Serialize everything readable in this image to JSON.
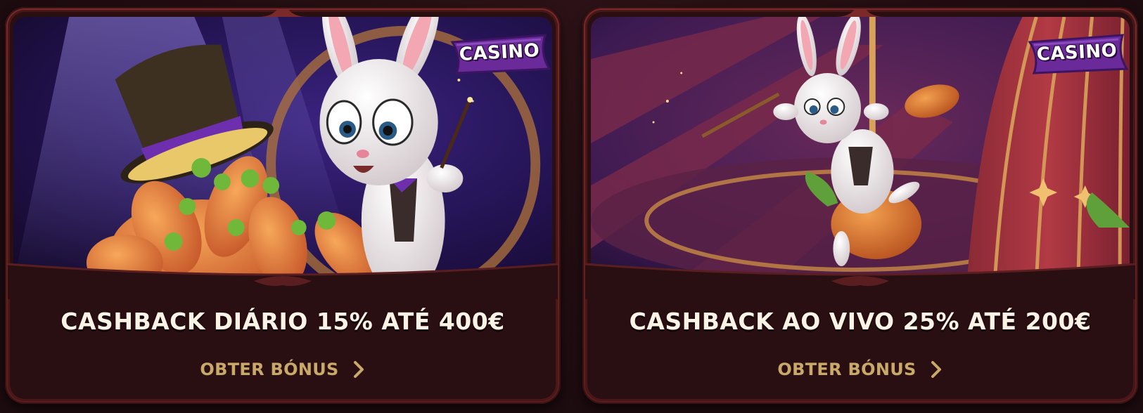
{
  "cards": [
    {
      "badge": "CASINO",
      "title": "CASHBACK DIÁRIO 15% ATÉ 400€",
      "cta_label": "OBTER BÓNUS",
      "cta_icon": "chevron-right-icon",
      "illustration": "magician-rabbit-with-top-hat-and-carrots"
    },
    {
      "badge": "CASINO",
      "title": "CASHBACK AO VIVO 25% ATÉ 200€",
      "cta_label": "OBTER BÓNUS",
      "cta_icon": "chevron-right-icon",
      "illustration": "rabbit-riding-carrot-on-carousel"
    }
  ],
  "colors": {
    "background": "#1d0c10",
    "card_frame": "#7a2a28",
    "card_panel": "#2a0f12",
    "badge": "#6a2a9a",
    "title_text": "#fbf3e6",
    "cta_text": "#c9a96a"
  }
}
